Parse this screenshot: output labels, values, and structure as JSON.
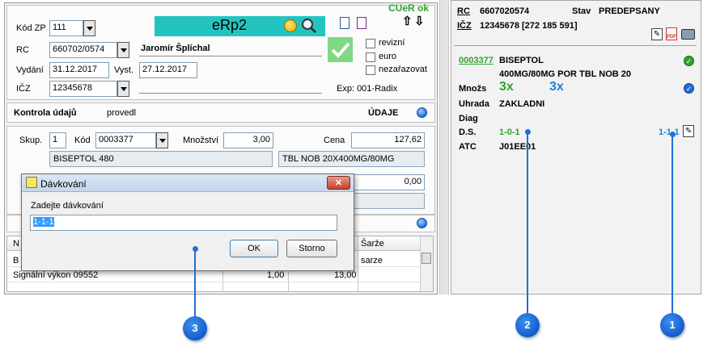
{
  "main_form": {
    "kod_zp_label": "Kód ZP",
    "kod_zp_value": "111",
    "app_title": "eRp2",
    "cuer_status": "CUeR ok",
    "rc_label": "RC",
    "rc_value": "660702/0574",
    "patient_name": "Jaromír Šplíchal",
    "vydani_label": "Vydání",
    "vydani_value": "31.12.2017",
    "vyst_label": "Vyst.",
    "vyst_value": "27.12.2017",
    "icz_label": "IČZ",
    "icz_value": "12345678",
    "revizni_label": "revizní",
    "euro_label": "euro",
    "nezarazovat_label": "nezařazovat",
    "exp_text": "Exp: 001-Radix",
    "kontrola_label": "Kontrola údajů",
    "provedl_label": "provedl",
    "udaje_label": "ÚDAJE"
  },
  "item_form": {
    "skup_label": "Skup.",
    "skup_value": "1",
    "kod_label": "Kód",
    "kod_value": "0003377",
    "mnozstvi_label": "Množství",
    "mnozstvi_value": "3,00",
    "cena_label": "Cena",
    "cena_value": "127,62",
    "drug_name": "BISEPTOL 480",
    "drug_form": "TBL NOB 20X400MG/80MG",
    "doplatek_value": "0,00"
  },
  "table": {
    "headers": [
      "N",
      "Šarže"
    ],
    "rows": [
      {
        "col1": "B",
        "col_sarze": "sarze"
      },
      {
        "col1": "Signální výkon 09552",
        "c2": "1,00",
        "c3": "13,00"
      }
    ]
  },
  "dialog": {
    "title": "Dávkování",
    "prompt": "Zadejte dávkování",
    "input_value": "1-1-1",
    "ok_label": "OK",
    "cancel_label": "Storno"
  },
  "right_panel": {
    "rc_label": "RC",
    "rc_value": "6607020574",
    "stav_label": "Stav",
    "stav_value": "PREDEPSANY",
    "icz_label": "IČZ",
    "icz_value": "12345678 [272 185 591]",
    "kod": "0003377",
    "name": "BISEPTOL",
    "detail": "400MG/80MG POR TBL NOB 20",
    "mnozs_label": "Množs",
    "mnozs_value1": "3x",
    "mnozs_value2": "3x",
    "uhrada_label": "Uhrada",
    "uhrada_value": "ZAKLADNI",
    "diag_label": "Diag",
    "ds_label": "D.S.",
    "ds_value1": "1-0-1",
    "ds_value2": "1-1-1",
    "atc_label": "ATC",
    "atc_value": "J01EE01"
  },
  "callouts": [
    "1",
    "2",
    "3"
  ],
  "colors": {
    "green": "#2ea52e",
    "blue": "#1f7fd9",
    "teal_banner": "#23c4c0",
    "callout_blue": "#1059c9"
  }
}
